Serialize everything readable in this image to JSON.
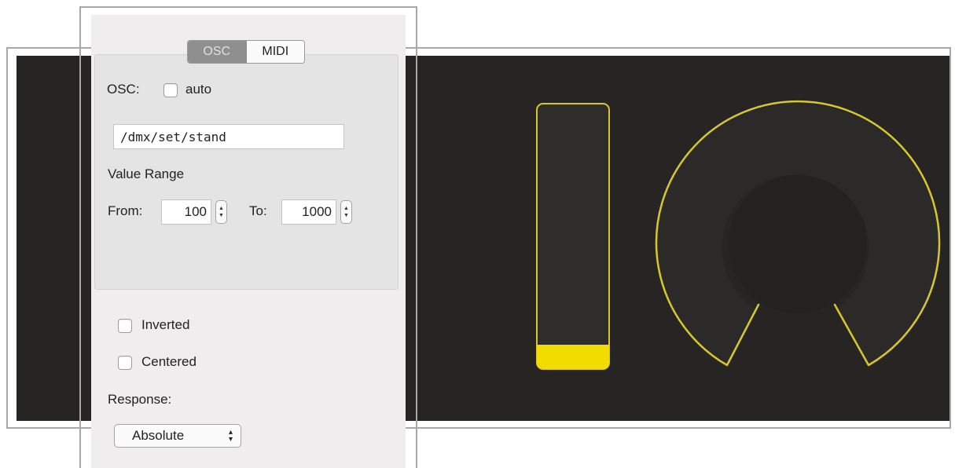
{
  "tabs": [
    {
      "label": "OSC",
      "active": true
    },
    {
      "label": "MIDI",
      "active": false
    }
  ],
  "osc": {
    "label": "OSC:",
    "auto_label": "auto",
    "auto_checked": false,
    "address": "/dmx/set/stand"
  },
  "value_range": {
    "title": "Value Range",
    "from_label": "From:",
    "from_value": "100",
    "to_label": "To:",
    "to_value": "1000"
  },
  "options": {
    "inverted_label": "Inverted",
    "inverted_checked": false,
    "centered_label": "Centered",
    "centered_checked": false
  },
  "response": {
    "label": "Response:",
    "selected": "Absolute"
  },
  "widgets": {
    "fader_level": 0.08,
    "knob_value": 0.0,
    "accent_color": "#f2dc00",
    "canvas_color": "#262523"
  }
}
